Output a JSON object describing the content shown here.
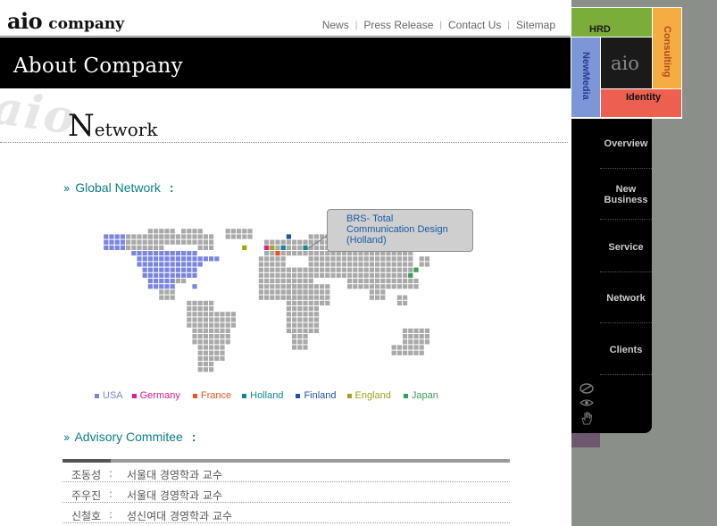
{
  "header": {
    "logo_part1": "aio",
    "logo_part2": "company",
    "nav": [
      {
        "label": "News"
      },
      {
        "label": "Press Release"
      },
      {
        "label": "Contact Us"
      },
      {
        "label": "Sitemap"
      }
    ]
  },
  "banner": {
    "title": "About Company"
  },
  "section": {
    "watermark": "aio",
    "title_initial": "N",
    "title_rest": "etwork"
  },
  "global": {
    "arrow": "››",
    "heading": "Global Network",
    "colon": ":",
    "callout_lines": [
      "BRS- Total",
      "Communication Design",
      "(Holland)"
    ],
    "legend": [
      {
        "label": "USA",
        "color": "#7b85e0"
      },
      {
        "label": "Germany",
        "color": "#e0198c"
      },
      {
        "label": "France",
        "color": "#e8541e"
      },
      {
        "label": "Holland",
        "color": "#138695"
      },
      {
        "label": "Finland",
        "color": "#1d55a8"
      },
      {
        "label": "England",
        "color": "#a3a31a"
      },
      {
        "label": "Japan",
        "color": "#3e9c5a"
      }
    ]
  },
  "advisory": {
    "arrow": "››",
    "heading": "Advisory Commitee",
    "colon": ":",
    "rows": [
      {
        "name": "조동성",
        "colon": ":",
        "desc": "서울대 경영학과 교수"
      },
      {
        "name": "주우진",
        "colon": ":",
        "desc": "서울대 경영학과 교수"
      },
      {
        "name": "신철호",
        "colon": ":",
        "desc": "성신여대 경영학과 교수"
      }
    ]
  },
  "brand": {
    "hrd": "HRD",
    "consulting": "Consulting",
    "newmedia": "NewMedia",
    "logo": "aio",
    "identity": "Identity",
    "colors": {
      "hrd": "#7bad3b",
      "consulting": "#f5ad43",
      "newmedia": "#7d96d8",
      "identity": "#ed6050"
    }
  },
  "sidenav": {
    "items": [
      {
        "lines": [
          "Overview"
        ]
      },
      {
        "lines": [
          "New",
          "Business"
        ]
      },
      {
        "lines": [
          "Service"
        ]
      },
      {
        "lines": [
          "Network"
        ]
      },
      {
        "lines": [
          "Clients"
        ]
      }
    ],
    "icons": [
      "coin-icon",
      "eye-icon",
      "hand-icon"
    ]
  },
  "colors": {
    "accent": "#0b7e86",
    "callout_text": "#1b5aa6",
    "map_gray": "#a9a9a9",
    "map_usa": "#7b85e0"
  }
}
